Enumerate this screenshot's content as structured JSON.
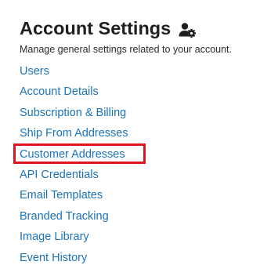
{
  "header": {
    "title": "Account Settings",
    "icon": "user-gear-icon"
  },
  "subtitle": "Manage general settings related to your account.",
  "menu": {
    "items": [
      {
        "label": "Users"
      },
      {
        "label": "Account Details"
      },
      {
        "label": "Subscription & Billing"
      },
      {
        "label": "Ship From Addresses"
      },
      {
        "label": "Customer Addresses",
        "highlighted": true
      },
      {
        "label": "API Credentials"
      },
      {
        "label": "Email Templates"
      },
      {
        "label": "Branded Tracking"
      },
      {
        "label": "Image Library"
      },
      {
        "label": "Event History"
      }
    ]
  },
  "colors": {
    "link": "#1a73b8",
    "title": "#1f1f1f",
    "highlight_border": "#e0141e"
  }
}
